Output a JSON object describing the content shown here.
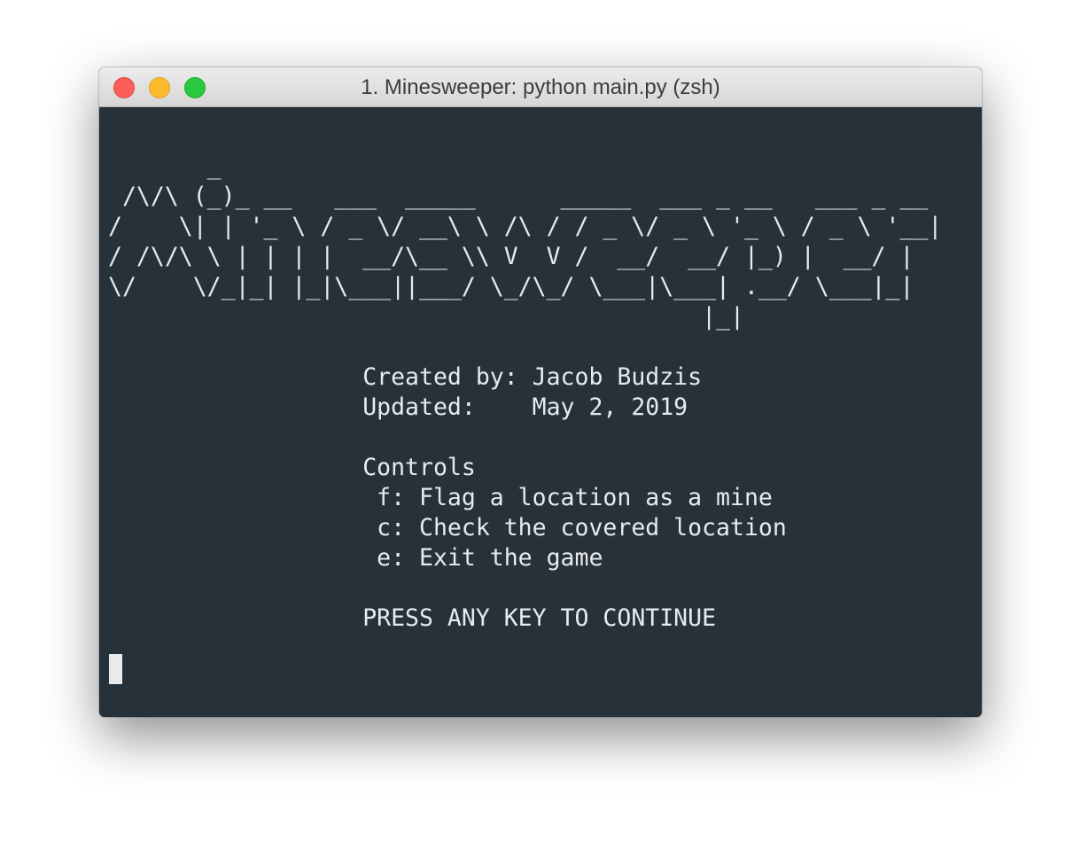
{
  "window": {
    "title": "1. Minesweeper: python main.py (zsh)"
  },
  "terminal": {
    "logo_lines": [
      "       _",
      " /\\/\\ (_)_ __   ___  _____      _____  ___ _ __   ___ _ __",
      "/    \\| | '_ \\ / _ \\/ __\\ \\ /\\ / / _ \\/ _ \\ '_ \\ / _ \\ '__|",
      "/ /\\/\\ \\ | | | |  __/\\__ \\\\ V  V /  __/  __/ |_) |  __/ |",
      "\\/    \\/_|_| |_|\\___||___/ \\_/\\_/ \\___|\\___| .__/ \\___|_|",
      "                                          |_|"
    ],
    "created_by": "Created by: Jacob Budzis",
    "updated": "Updated:    May 2, 2019",
    "controls_heading": "Controls",
    "control_flag": " f: Flag a location as a mine",
    "control_check": " c: Check the covered location",
    "control_exit": " e: Exit the game",
    "prompt": "PRESS ANY KEY TO CONTINUE"
  }
}
